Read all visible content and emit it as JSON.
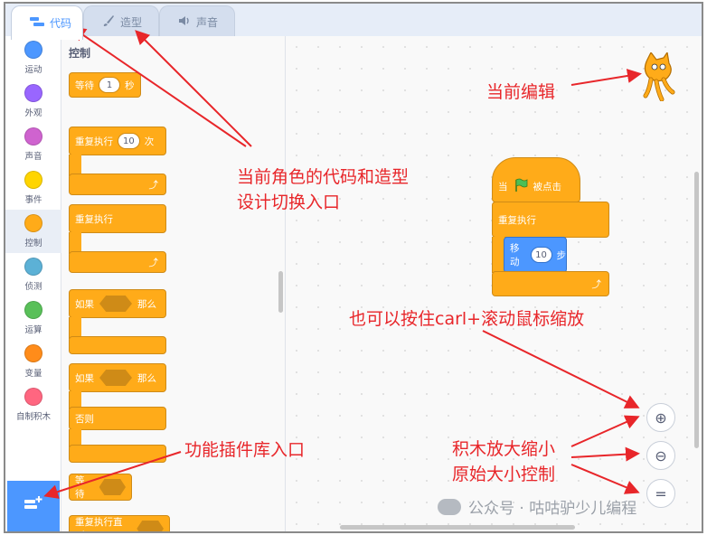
{
  "tabs": [
    {
      "label": "代码",
      "icon": "code-icon"
    },
    {
      "label": "造型",
      "icon": "brush-icon"
    },
    {
      "label": "声音",
      "icon": "speaker-icon"
    }
  ],
  "categories": [
    {
      "label": "运动",
      "color": "#4c97ff"
    },
    {
      "label": "外观",
      "color": "#9966ff"
    },
    {
      "label": "声音",
      "color": "#cf63cf"
    },
    {
      "label": "事件",
      "color": "#ffd500"
    },
    {
      "label": "控制",
      "color": "#ffab19"
    },
    {
      "label": "侦测",
      "color": "#5cb1d6"
    },
    {
      "label": "运算",
      "color": "#59c059"
    },
    {
      "label": "变量",
      "color": "#ff8c1a"
    },
    {
      "label": "自制积木",
      "color": "#ff6680"
    }
  ],
  "palette": {
    "title": "控制",
    "wait": {
      "label": "等待",
      "value": "1",
      "unit": "秒"
    },
    "repeat": {
      "label": "重复执行",
      "value": "10",
      "unit": "次"
    },
    "forever": {
      "label": "重复执行"
    },
    "if_then": {
      "if": "如果",
      "then": "那么"
    },
    "if_else": {
      "if": "如果",
      "then": "那么",
      "else": "否则"
    },
    "wait_until": {
      "label": "等待"
    },
    "repeat_until": {
      "label": "重复执行直到"
    }
  },
  "script": {
    "hat": {
      "when": "当",
      "clicked": "被点击"
    },
    "forever": "重复执行",
    "move": {
      "label": "移动",
      "value": "10",
      "unit": "步"
    }
  },
  "annotations": {
    "current_edit": "当前编辑",
    "tabs_note_line1": "当前角色的代码和造型",
    "tabs_note_line2": "设计切换入口",
    "zoom_note": "也可以按住carl+滚动鼠标缩放",
    "zoom_ctrl_line1": "积木放大缩小",
    "zoom_ctrl_line2": "原始大小控制",
    "extension_note": "功能插件库入口"
  },
  "zoom": {
    "in": "⊕",
    "out": "⊖",
    "reset": "="
  },
  "watermark": "公众号 · 咕咕驴少儿编程",
  "colors": {
    "accent": "#4c97ff",
    "control": "#ffab19",
    "annotation": "#e8262a",
    "event": "#ffbf00"
  }
}
